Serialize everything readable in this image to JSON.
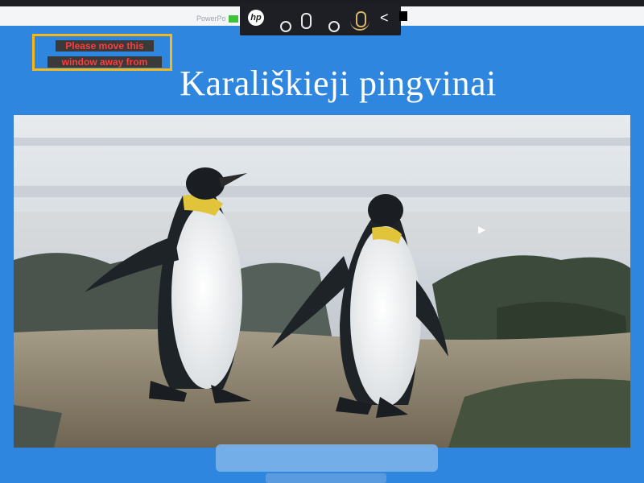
{
  "app": {
    "title_fragment": "PowerPo"
  },
  "camera_toolbar": {
    "logo_text": "hp",
    "collapse_glyph": "<"
  },
  "warning": {
    "line1": "Please move this",
    "line2": "window away from"
  },
  "slide": {
    "title": "Karališkieji pingvinai"
  },
  "colors": {
    "slide_background": "#2f86de",
    "warning_border": "#f6b71a",
    "warning_text": "#ff3d3d"
  },
  "icons": {
    "logo": "hp-logo-icon",
    "camera_off": "circle-icon",
    "mic": "microphone-icon",
    "record": "record-icon",
    "mic_active": "microphone-active-icon",
    "collapse": "chevron-left-icon"
  }
}
